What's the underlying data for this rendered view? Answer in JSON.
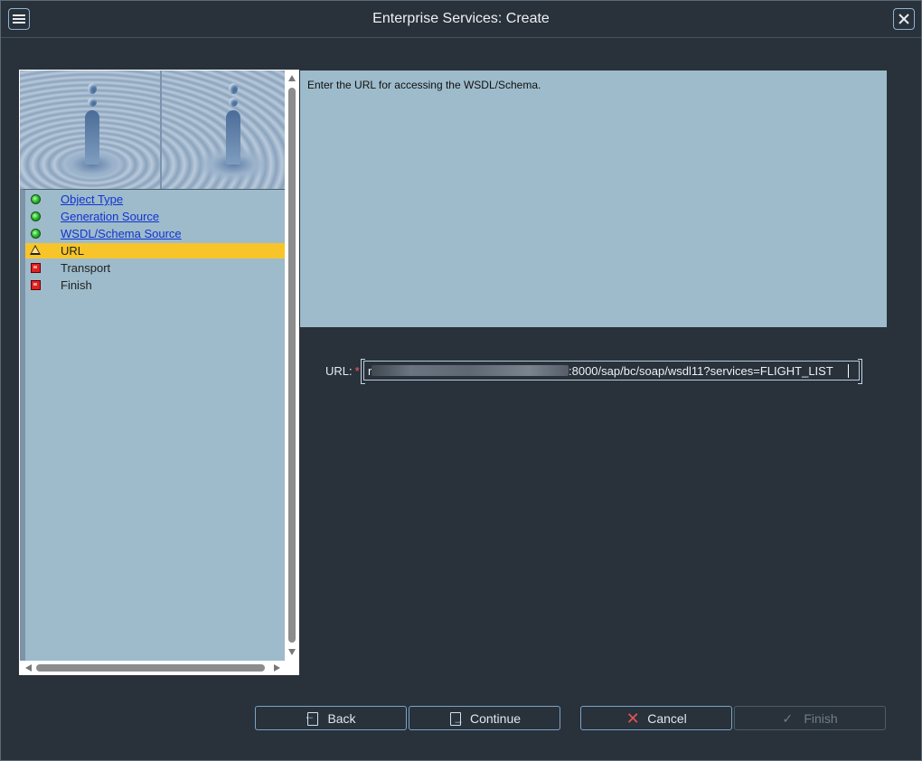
{
  "window": {
    "title": "Enterprise Services: Create",
    "menu_icon": "hamburger-menu-icon",
    "close_icon": "close-icon"
  },
  "wizard_steps": [
    {
      "label": "Object Type",
      "status": "complete",
      "status_color": "#2bc02b",
      "link": true
    },
    {
      "label": "Generation Source",
      "status": "complete",
      "status_color": "#2bc02b",
      "link": true
    },
    {
      "label": "WSDL/Schema Source",
      "status": "complete",
      "status_color": "#2bc02b",
      "link": true
    },
    {
      "label": "URL",
      "status": "current-warning",
      "status_color": "#f7c52a",
      "link": false
    },
    {
      "label": "Transport",
      "status": "pending",
      "status_color": "#dd2222",
      "link": false
    },
    {
      "label": "Finish",
      "status": "pending",
      "status_color": "#dd2222",
      "link": false
    }
  ],
  "info": {
    "text": "Enter the URL for accessing the WSDL/Schema."
  },
  "url_field": {
    "label": "URL:",
    "required_marker": "*",
    "value_visible_prefix": "r",
    "value_visible_suffix": ":8000/sap/bc/soap/wsdl11?services=FLIGHT_LIST"
  },
  "buttons": {
    "back": "Back",
    "continue": "Continue",
    "cancel": "Cancel",
    "finish": "Finish"
  },
  "colors": {
    "background": "#29313a",
    "panel": "#9dbbcb",
    "active_step": "#f7c52a",
    "link": "#1233d1"
  }
}
